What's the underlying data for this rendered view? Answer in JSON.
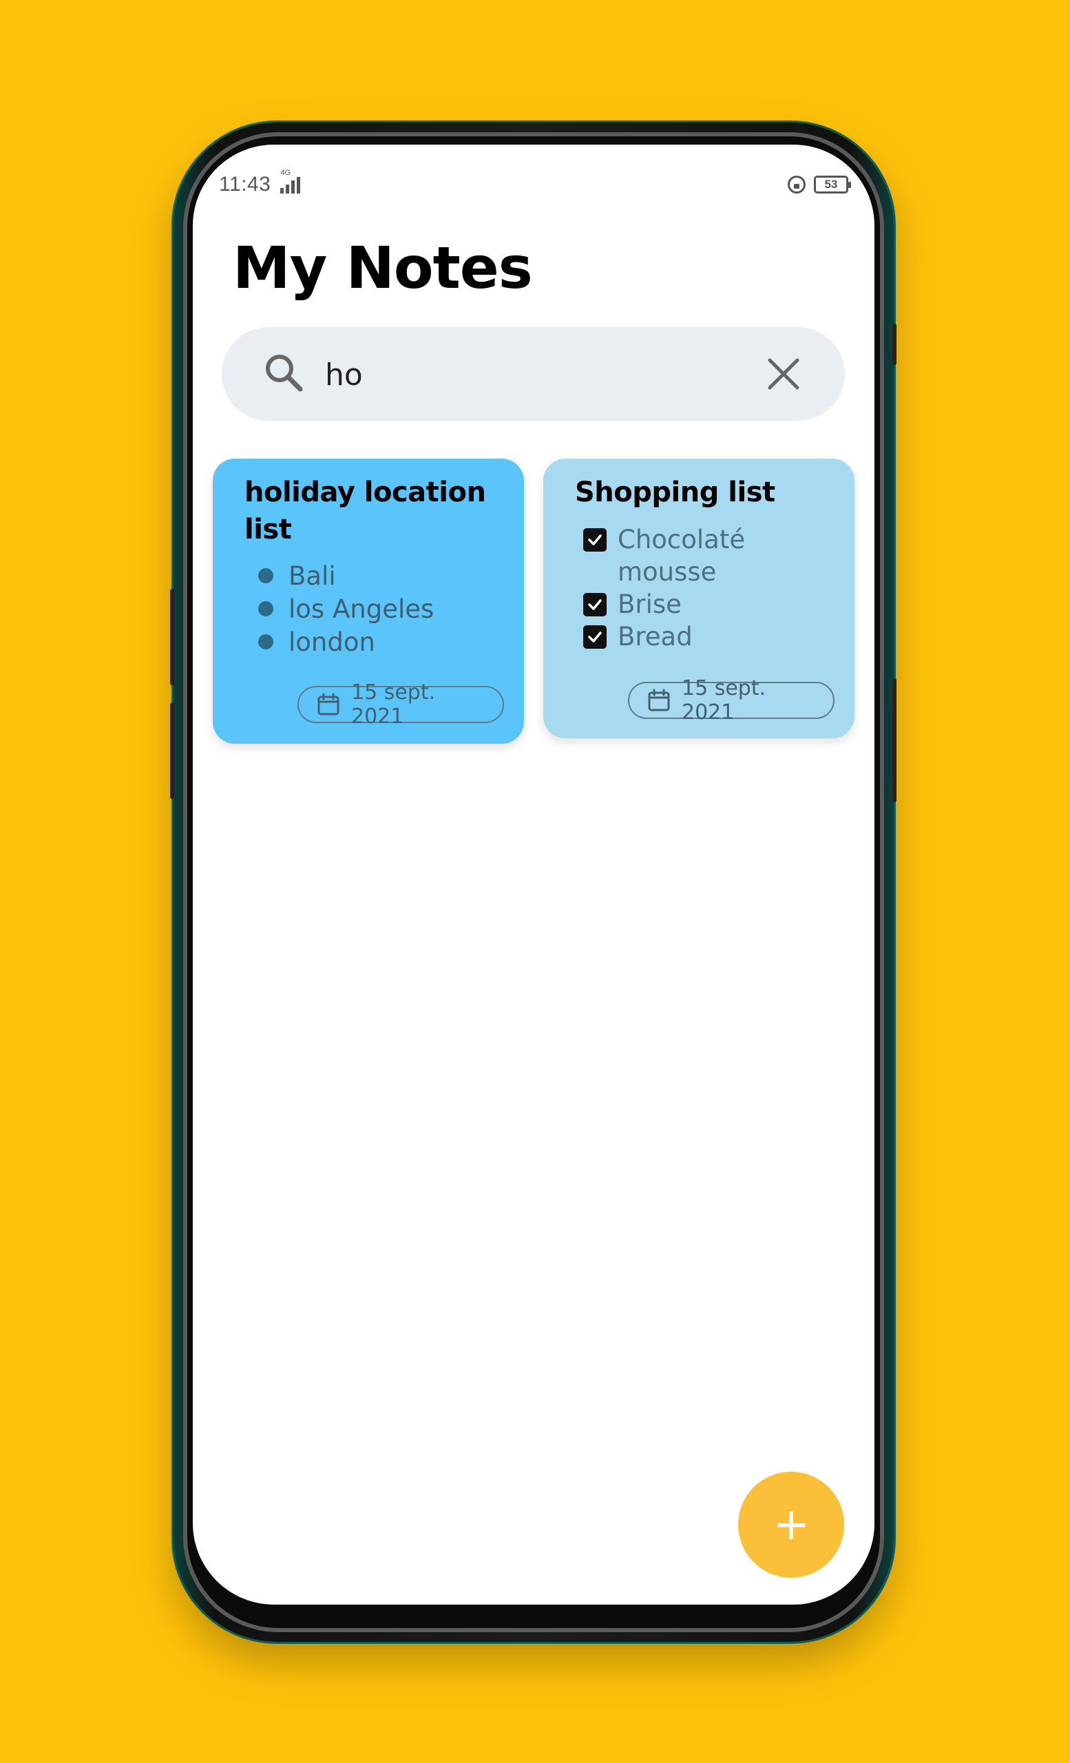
{
  "status_bar": {
    "time": "11:43",
    "network": "4G",
    "battery": "53"
  },
  "header": {
    "title": "My Notes"
  },
  "search": {
    "value": "ho",
    "icon": "search-icon",
    "clear_icon": "close-icon"
  },
  "notes": [
    {
      "title": "holiday location list",
      "type": "bullets",
      "color": "#5BC5FB",
      "items": [
        "Bali",
        "los Angeles",
        "london"
      ],
      "date": "15 sept. 2021"
    },
    {
      "title": "Shopping list",
      "type": "checklist",
      "color": "#A7D9F0",
      "items": [
        {
          "label": "Chocolaté mousse",
          "checked": true
        },
        {
          "label": "Brise",
          "checked": true
        },
        {
          "label": "Bread",
          "checked": true
        }
      ],
      "date": "15 sept. 2021"
    }
  ],
  "fab": {
    "label": "+",
    "color": "#FBBF3A"
  },
  "colors": {
    "background": "#FEC10B",
    "screen": "#FFFFFF",
    "search_bg": "#E9EEF2"
  }
}
